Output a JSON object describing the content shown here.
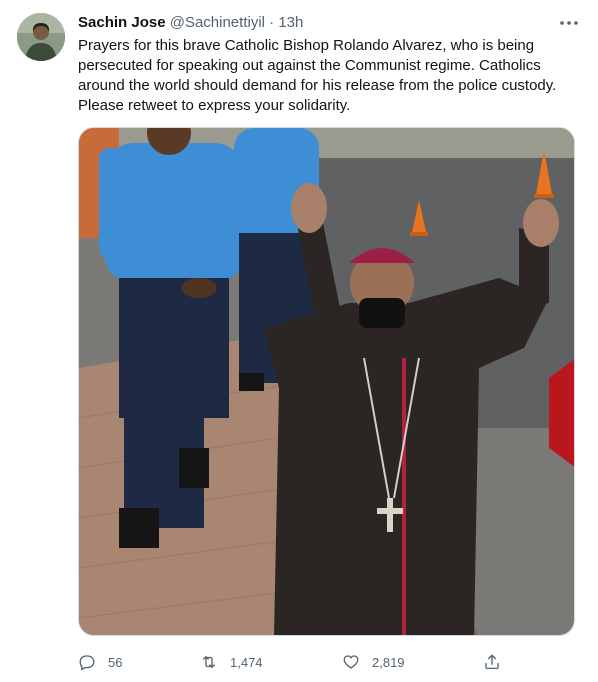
{
  "tweet": {
    "author_name": "Sachin Jose",
    "handle": "@Sachinettiyil",
    "separator": "·",
    "time": "13h",
    "text": "Prayers for this brave Catholic Bishop Rolando Alvarez, who is being persecuted for speaking out against the Communist regime. Catholics around the world should demand for his release from the police custody. Please retweet to express your solidarity.",
    "more_icon": "more-horizontal-icon"
  },
  "actions": {
    "reply": {
      "icon": "reply-icon",
      "count": "56"
    },
    "retweet": {
      "icon": "retweet-icon",
      "count": "1,474"
    },
    "like": {
      "icon": "heart-icon",
      "count": "2,819"
    },
    "share": {
      "icon": "share-icon"
    }
  },
  "colors": {
    "text": "#0f1419",
    "secondary": "#536471",
    "border": "#cfd9de"
  }
}
